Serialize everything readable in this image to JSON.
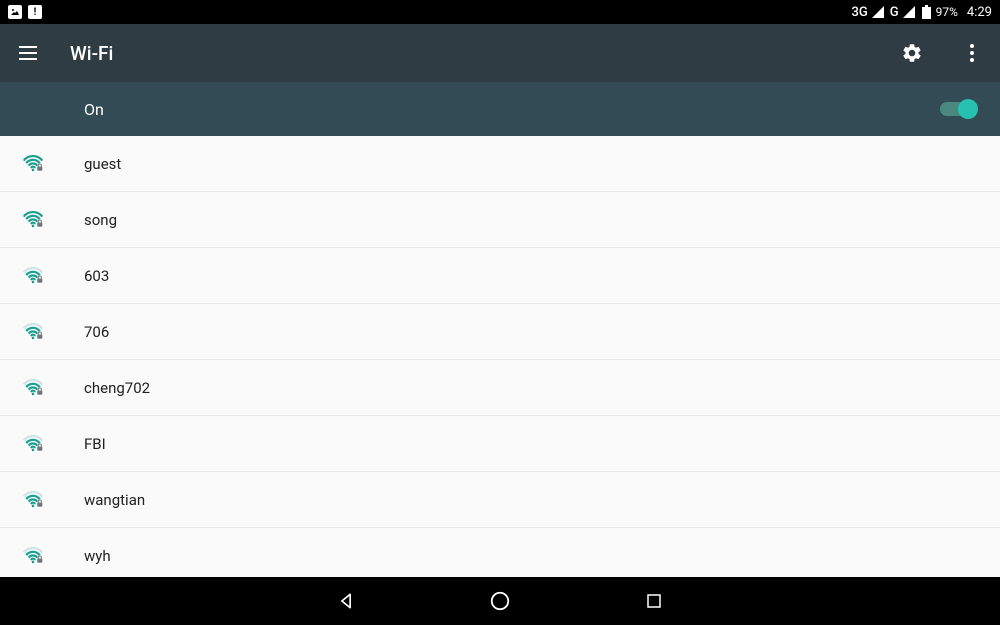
{
  "status": {
    "network_3g": "3G",
    "network_g": "G",
    "battery_pct": "97%",
    "time": "4:29"
  },
  "header": {
    "title": "Wi-Fi"
  },
  "toggle": {
    "label": "On",
    "state": true
  },
  "networks": [
    {
      "ssid": "guest",
      "strength": 4,
      "secured": true
    },
    {
      "ssid": "song",
      "strength": 4,
      "secured": true
    },
    {
      "ssid": "603",
      "strength": 3,
      "secured": true
    },
    {
      "ssid": "706",
      "strength": 3,
      "secured": true
    },
    {
      "ssid": "cheng702",
      "strength": 3,
      "secured": true
    },
    {
      "ssid": "FBI",
      "strength": 3,
      "secured": true
    },
    {
      "ssid": "wangtian",
      "strength": 3,
      "secured": true
    },
    {
      "ssid": "wyh",
      "strength": 3,
      "secured": true
    }
  ],
  "colors": {
    "accent": "#26c1b0",
    "appbar_bg": "#2f3c43",
    "toggle_bg": "#334b55"
  }
}
